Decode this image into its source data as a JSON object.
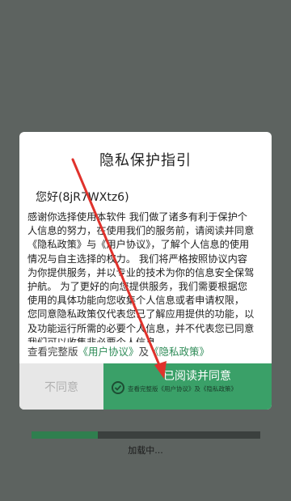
{
  "dialog": {
    "title": "隐私保护指引",
    "greeting": "您好(8jR7WXtz6)",
    "body": "感谢你选择使用本软件 我们做了诸多有利于保护个人信息的努力，在使用我们的服务前，请阅读并同意《隐私政策》与《用户协议》，了解个人信息的使用情况与自主选择的权力。 我们将严格按照协议内容为你提供服务，并以专业的技术为你的信息安全保驾护航。 为了更好的向您提供服务，我们需要根据您使用的具体功能向您收集个人信息或者申请权限， 您同意隐私政策仅代表您已了解应用提供的功能，以及功能运行所需的必要个人信息，并不代表您已同意我们可以收集非必要个人信息。",
    "links": {
      "prefix": "查看完整版",
      "user_agreement": "《用户协议》",
      "and": "及",
      "privacy_policy": "《隐私政策》"
    },
    "decline_label": "不同意",
    "accept_label": "已阅读并同意",
    "accept_sublabel": "查看完整版《用户协议》及《隐私政策》"
  },
  "loading": {
    "label": "加载中...",
    "progress": 0.29
  },
  "colors": {
    "accent": "#3aa068",
    "link": "#2e8b57",
    "arrow": "#e0322c",
    "overlay": "#5d6360"
  }
}
